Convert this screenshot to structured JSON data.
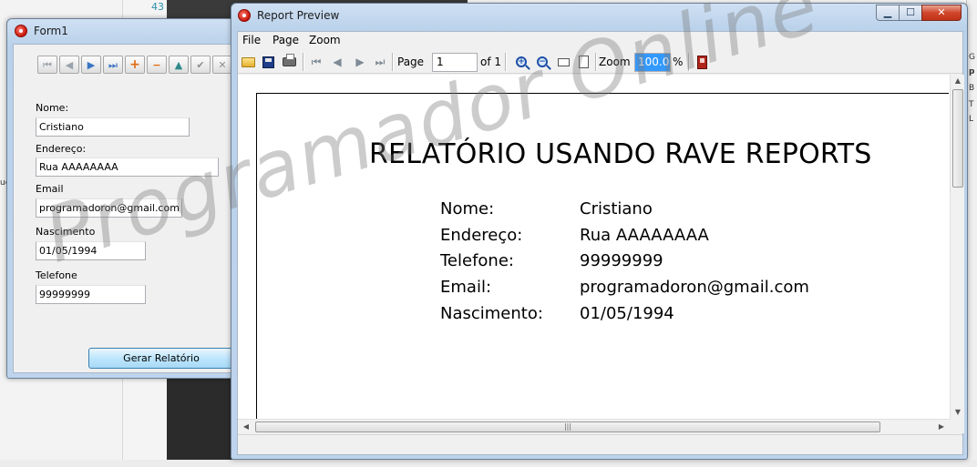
{
  "background_editor": {
    "line_number": "43",
    "right_edge_letters": [
      "G",
      "p",
      "B",
      "T",
      "L"
    ],
    "left_edge_letter": "ue"
  },
  "form1": {
    "title": "Form1",
    "navigator": {
      "buttons": [
        {
          "icon": "first-record-icon",
          "glyph": "⏮"
        },
        {
          "icon": "prior-record-icon",
          "glyph": "◀"
        },
        {
          "icon": "next-record-icon",
          "glyph": "▶"
        },
        {
          "icon": "last-record-icon",
          "glyph": "⏭"
        },
        {
          "icon": "insert-record-icon",
          "glyph": "+"
        },
        {
          "icon": "delete-record-icon",
          "glyph": "−"
        },
        {
          "icon": "edit-record-icon",
          "glyph": "▲"
        },
        {
          "icon": "post-record-icon",
          "glyph": "✔"
        },
        {
          "icon": "cancel-record-icon",
          "glyph": "✕"
        }
      ]
    },
    "fields": {
      "nome_label": "Nome:",
      "nome_value": "Cristiano",
      "endereco_label": "Endereço:",
      "endereco_value": "Rua AAAAAAAA",
      "email_label": "Email",
      "email_value": "programadoron@gmail.com",
      "nascimento_label": "Nascimento",
      "nascimento_value": "01/05/1994",
      "telefone_label": "Telefone",
      "telefone_value": "99999999"
    },
    "generate_button": "Gerar Relatório"
  },
  "report_preview": {
    "title": "Report Preview",
    "window_controls": {
      "minimize": "▁",
      "maximize": "☐",
      "close": "✕"
    },
    "menu": [
      "File",
      "Page",
      "Zoom"
    ],
    "toolbar": {
      "page_label": "Page",
      "page_value": "1",
      "of_label": "of 1",
      "zoom_label": "Zoom",
      "zoom_value": "100.0",
      "zoom_unit": "%"
    },
    "report": {
      "title": "RELATÓRIO USANDO RAVE REPORTS",
      "rows": [
        {
          "label": "Nome:",
          "value": "Cristiano"
        },
        {
          "label": "Endereço:",
          "value": "Rua AAAAAAAA"
        },
        {
          "label": "Telefone:",
          "value": "99999999"
        },
        {
          "label": "Email:",
          "value": "programadoron@gmail.com"
        },
        {
          "label": "Nascimento:",
          "value": "01/05/1994"
        }
      ]
    }
  },
  "watermark": "Programador Online",
  "colors": {
    "titlebar": "#b9d1ea",
    "close_button": "#c03215",
    "selection": "#3399ff",
    "navigator_blue": "#3a74c2",
    "navigator_orange": "#e06b10"
  }
}
